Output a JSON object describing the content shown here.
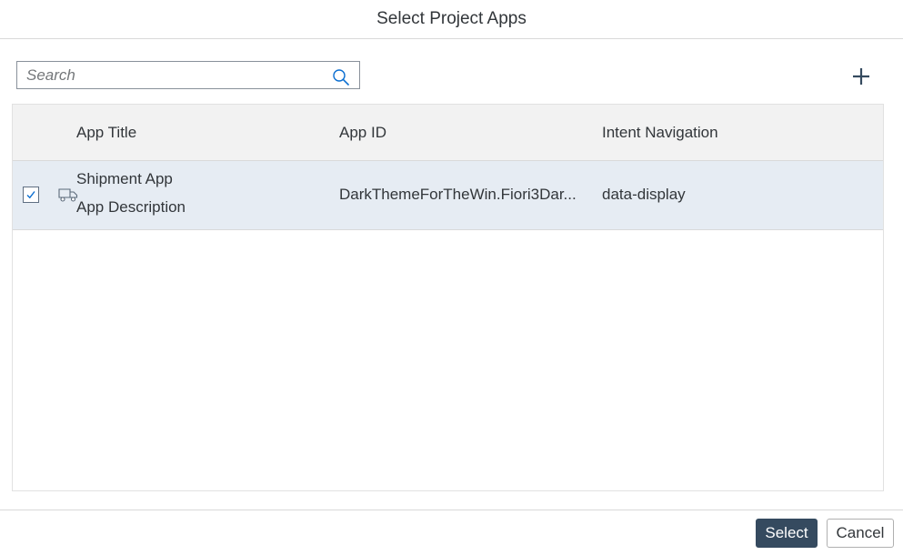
{
  "dialog": {
    "title": "Select Project Apps"
  },
  "search": {
    "placeholder": "Search",
    "value": ""
  },
  "toolbar": {
    "add_icon": "plus-icon"
  },
  "table": {
    "columns": [
      "App Title",
      "App ID",
      "Intent Navigation"
    ],
    "rows": [
      {
        "selected": true,
        "icon": "shipping-truck-icon",
        "title": "Shipment App",
        "description": "App Description",
        "app_id": "DarkThemeForTheWin.Fiori3Dar...",
        "intent": "data-display"
      }
    ]
  },
  "footer": {
    "select_label": "Select",
    "cancel_label": "Cancel"
  },
  "colors": {
    "accent": "#354a5f",
    "selected_row": "#e6ecf3",
    "header_bg": "#f2f2f2"
  }
}
